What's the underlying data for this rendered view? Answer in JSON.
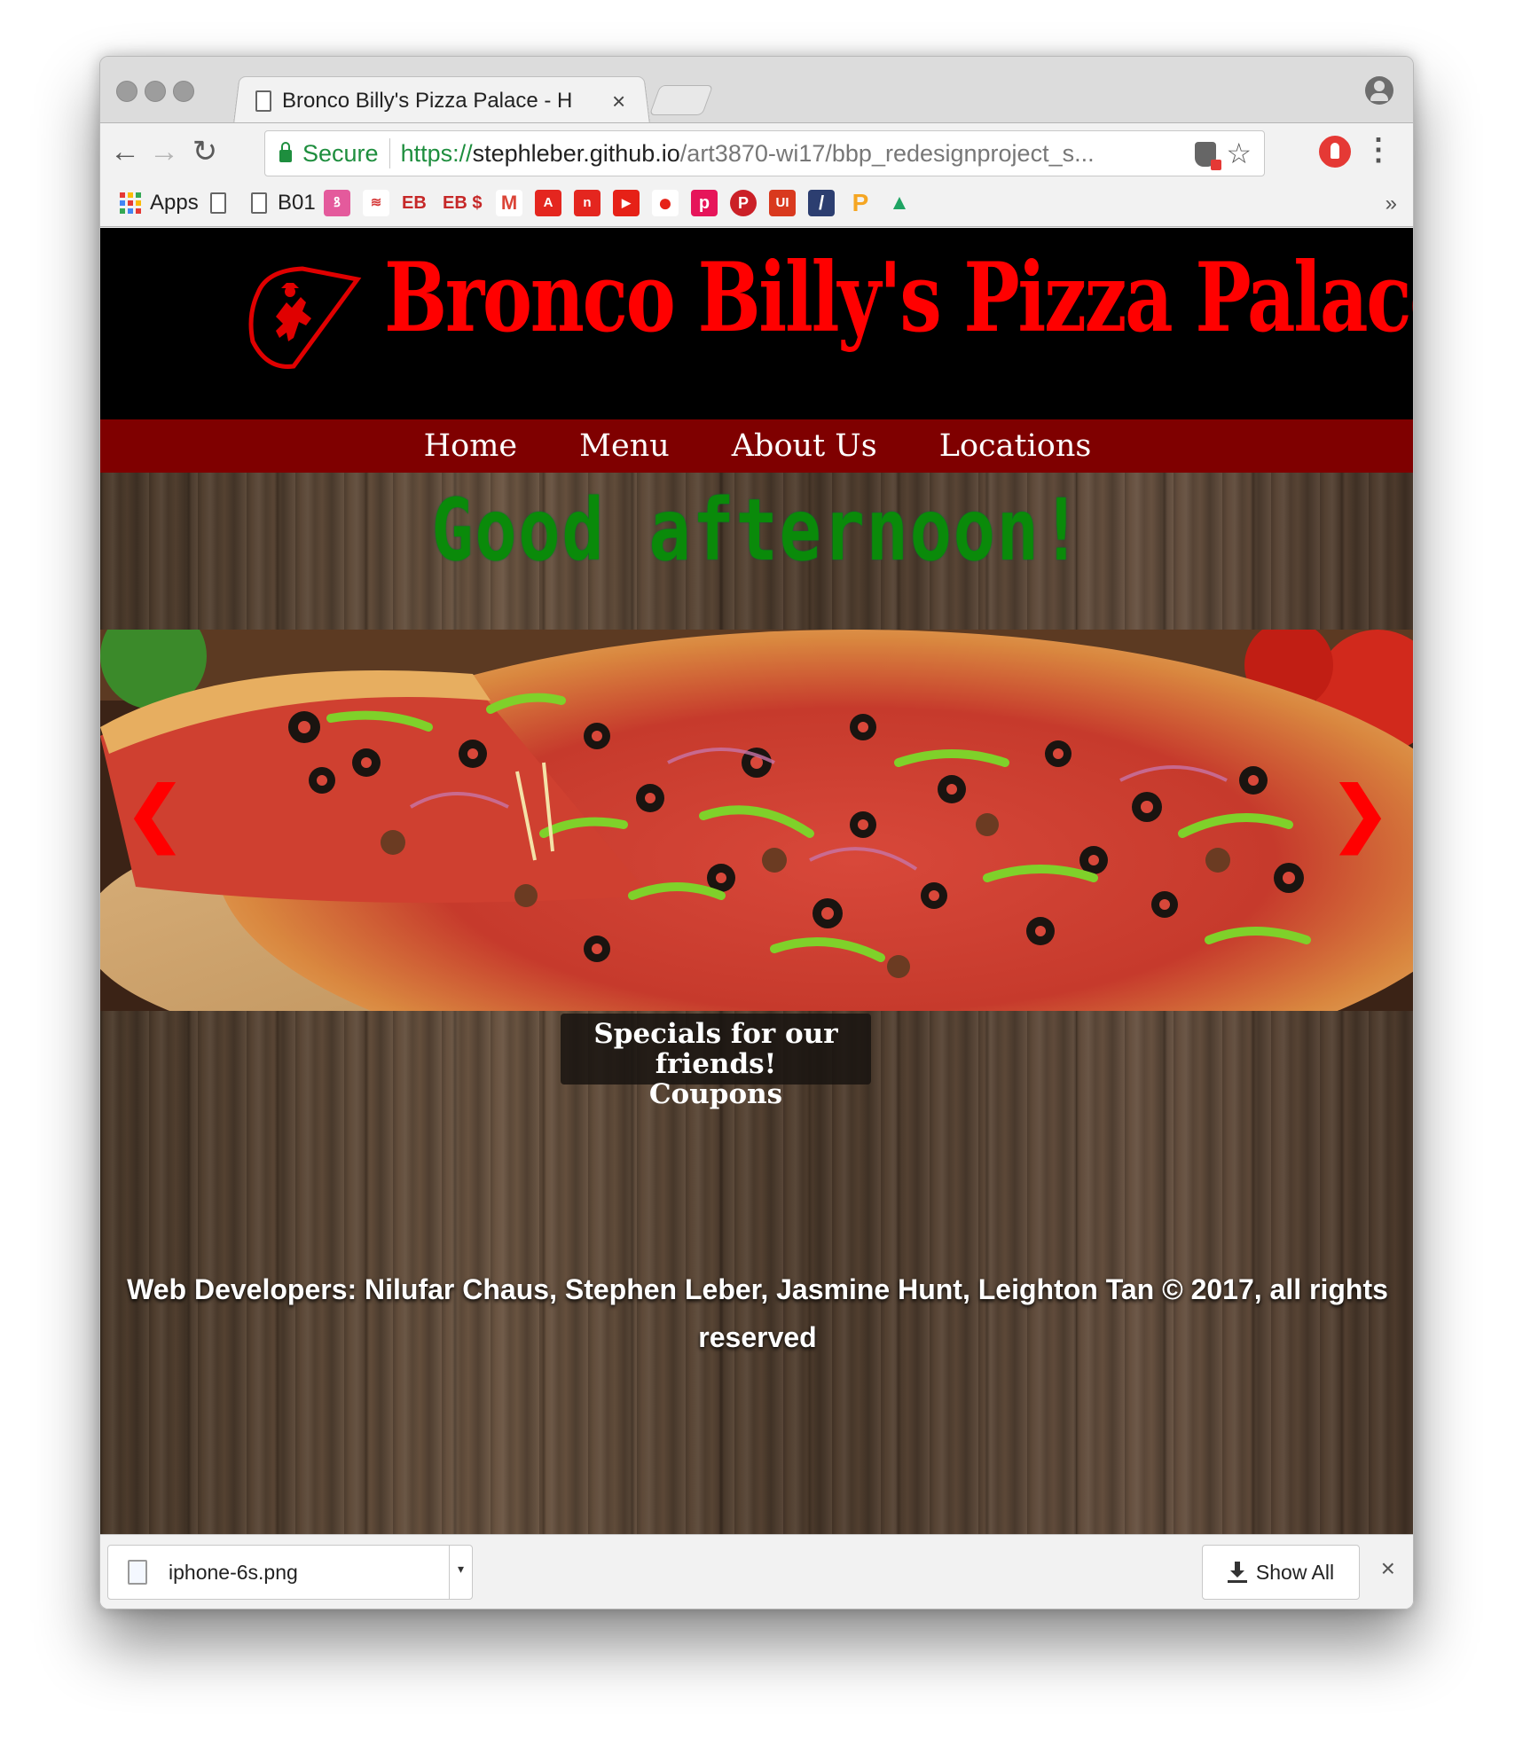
{
  "browser": {
    "tab_title": "Bronco Billy's Pizza Palace - H",
    "tab_close": "×",
    "secure_label": "Secure",
    "url_scheme": "https://",
    "url_host": "stephleber.github.io",
    "url_path": "/art3870-wi17/bbp_redesignproject_s...",
    "star": "☆",
    "menu": "⋮",
    "back": "←",
    "forward": "→",
    "reload": "↻"
  },
  "bookmarks": {
    "apps_label": "Apps",
    "b01_label": "B01",
    "eb_label": "EB",
    "eb_dollar_label": "EB $",
    "more": "»",
    "favicons": [
      {
        "name": "link-favicon",
        "color": "#e45a9c",
        "glyph": "ꝸ"
      },
      {
        "name": "bank-favicon",
        "color": "#d63b3b",
        "glyph": "≋"
      },
      {
        "name": "gmail-favicon",
        "color": "#ffffff",
        "glyph": "M",
        "fg": "#db4437"
      },
      {
        "name": "adobe-favicon",
        "color": "#e4261f",
        "glyph": "A"
      },
      {
        "name": "nedit-favicon",
        "color": "#e4261f",
        "glyph": "n"
      },
      {
        "name": "youtube-favicon",
        "color": "#e62117",
        "glyph": "▶"
      },
      {
        "name": "circle-favicon",
        "color": "#e62117",
        "glyph": "●"
      },
      {
        "name": "p-favicon",
        "color": "#e6155a",
        "glyph": "p"
      },
      {
        "name": "pinterest-favicon",
        "color": "#cb2027",
        "glyph": "P"
      },
      {
        "name": "ui-favicon",
        "color": "#d9391e",
        "glyph": "UI"
      },
      {
        "name": "stripe-favicon",
        "color": "#2c3e70",
        "glyph": "/"
      },
      {
        "name": "p-yellow-favicon",
        "color": "#f5a623",
        "glyph": "P"
      },
      {
        "name": "drive-favicon",
        "color": "#1fa463",
        "glyph": "▲"
      }
    ]
  },
  "site": {
    "title": "Bronco Billy's Pizza Palace",
    "nav": [
      "Home",
      "Menu",
      "About Us",
      "Locations"
    ],
    "greeting": "Good afternoon!",
    "caption_line1": "Specials for our friends!",
    "caption_line2": "Coupons",
    "prev_arrow": "❮",
    "next_arrow": "❯",
    "footer": "Web Developers: Nilufar Chaus, Stephen Leber, Jasmine Hunt, Leighton Tan © 2017, all rights reserved",
    "colors": {
      "title": "#ff0000",
      "nav_bg": "#7f0000",
      "greeting": "#0a8a0a"
    }
  },
  "downloads": {
    "file_name": "iphone-6s.png",
    "menu_caret": "▾",
    "show_all": "Show All",
    "close": "×"
  }
}
